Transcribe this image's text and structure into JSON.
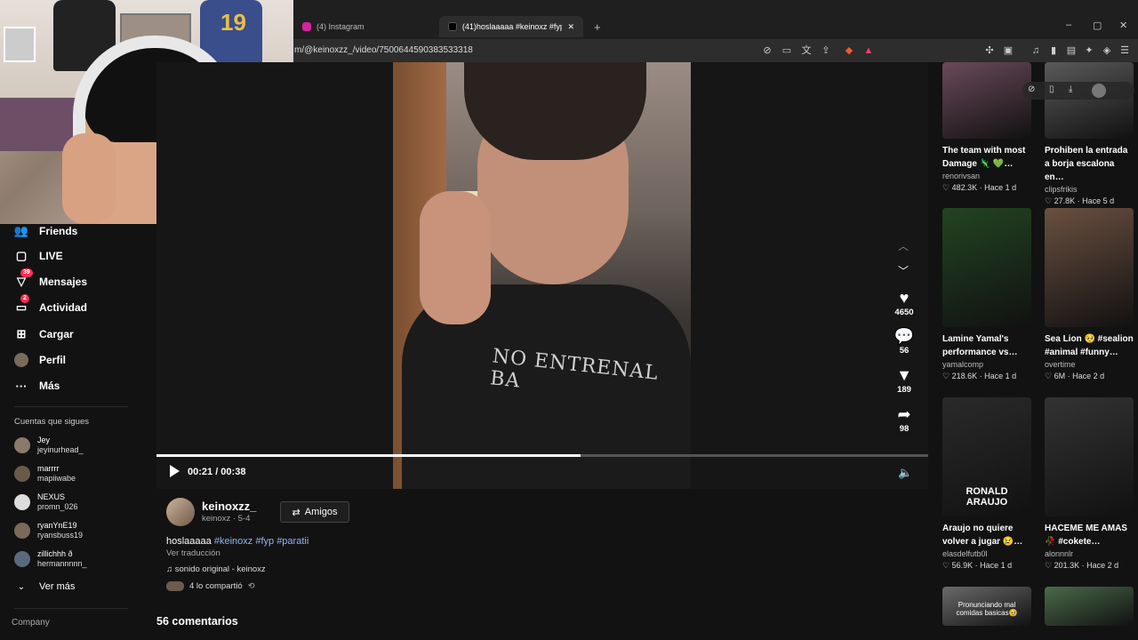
{
  "browser": {
    "tabs": [
      {
        "title": "(4) Instagram",
        "active": false,
        "favicon_color": "#d6249f"
      },
      {
        "title": "(41)hoslaaaaa #keinoxz #fyp #p…",
        "active": true,
        "favicon_color": "#000000"
      }
    ],
    "new_tab_symbol": "+",
    "url": "m/@keinoxzz_/video/7500644590383533318",
    "window_controls": [
      "–",
      "▢",
      "✕"
    ]
  },
  "sidebar": {
    "items": [
      {
        "label": "Friends",
        "icon": "friends-icon",
        "badge": ""
      },
      {
        "label": "LIVE",
        "icon": "live-icon",
        "badge": ""
      },
      {
        "label": "Mensajes",
        "icon": "messages-icon",
        "badge": "39"
      },
      {
        "label": "Actividad",
        "icon": "activity-icon",
        "badge": "2"
      },
      {
        "label": "Cargar",
        "icon": "upload-icon",
        "badge": ""
      },
      {
        "label": "Perfil",
        "icon": "profile-icon",
        "badge": ""
      },
      {
        "label": "Más",
        "icon": "more-icon",
        "badge": ""
      }
    ],
    "following_title": "Cuentas que sigues",
    "following": [
      {
        "name": "Jey",
        "handle": "jeyinurhead_",
        "color": "#8a7a6a"
      },
      {
        "name": "marrrr",
        "handle": "mapiiwabe",
        "color": "#6a5a4a"
      },
      {
        "name": "NEXUS",
        "handle": "promn_026",
        "color": "#dddddd"
      },
      {
        "name": "ryanYnE19",
        "handle": "ryansbuss19",
        "color": "#7a6a5a"
      },
      {
        "name": "zillichhh ð",
        "handle": "hermannnnn_",
        "color": "#5a6a7a"
      }
    ],
    "see_more": "Ver más",
    "company": "Company"
  },
  "video": {
    "progress": 0.55,
    "time": "00:21 / 00:38",
    "shirt_text": "NO ENTRENAL BA",
    "actions": [
      {
        "icon": "heart-icon",
        "count": "4650"
      },
      {
        "icon": "comment-icon",
        "count": "56"
      },
      {
        "icon": "bookmark-icon",
        "count": "189"
      },
      {
        "icon": "share-icon",
        "count": "98"
      }
    ]
  },
  "author": {
    "name": "keinoxzz_",
    "sub": "keinoxz · 5-4",
    "friends_button": "Amigos",
    "description_text": "hoslaaaaa",
    "tags": [
      "#keinoxz",
      "#fyp",
      "#paratii"
    ],
    "translate": "Ver traducción",
    "sound": "sonido original - keinoxz",
    "shared": "4 lo compartió"
  },
  "comments_count": "56 comentarios",
  "recommended": [
    {
      "title": "The team with most Damage 🦎 💚…",
      "user": "renorivsan",
      "likes": "482.3K",
      "age": "Hace 1 d",
      "color": "#6a4a5a"
    },
    {
      "title": "Prohiben la entrada a borja escalona en…",
      "user": "clipsfrikis",
      "likes": "27.8K",
      "age": "Hace 5 d",
      "color": "#5a5a5a"
    },
    {
      "title": "Lamine Yamal's performance vs…",
      "user": "yamalcomp",
      "likes": "218.6K",
      "age": "Hace 1 d",
      "color": "#224422"
    },
    {
      "title": "Sea Lion 🥺 #sealion #animal #funny…",
      "user": "overtime",
      "likes": "6M",
      "age": "Hace 2 d",
      "color": "#6a5040"
    },
    {
      "title": "Araujo no quiere volver a jugar 😢…",
      "user": "elasdelfutb0l",
      "likes": "56.9K",
      "age": "Hace 1 d",
      "color": "#2a2a2a",
      "thumb_text": "RONALD ARAUJO"
    },
    {
      "title": "HACEME ME AMAS 🥀 #cokete…",
      "user": "alonnnlr",
      "likes": "201.3K",
      "age": "Hace 2 d",
      "color": "#333333"
    },
    {
      "title": "",
      "user": "",
      "likes": "",
      "age": "",
      "color": "#6a6a6a",
      "thumb_text": "Pronunciando mal comidas basicas🥹"
    },
    {
      "title": "",
      "user": "",
      "likes": "",
      "age": "",
      "color": "#4a6a4a"
    }
  ]
}
